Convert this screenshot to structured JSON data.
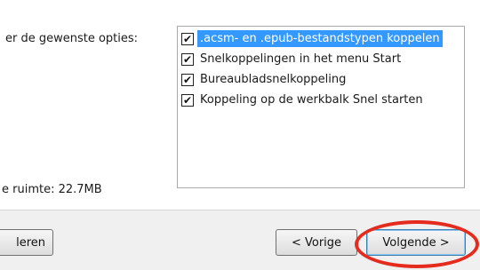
{
  "instruction": "er de gewenste opties:",
  "options": [
    {
      "label": ".acsm- en .epub-bestandstypen koppelen",
      "checked": true,
      "selected": true
    },
    {
      "label": "Snelkoppelingen in het menu Start",
      "checked": true,
      "selected": false
    },
    {
      "label": "Bureaubladsnelkoppeling",
      "checked": true,
      "selected": false
    },
    {
      "label": "Koppeling op de werkbalk Snel starten",
      "checked": true,
      "selected": false
    }
  ],
  "space_required": "e ruimte: 22.7MB",
  "buttons": {
    "cancel": "leren",
    "back": "< Vorige",
    "next": "Volgende >"
  },
  "checkmark": "✔",
  "highlight_color": "#e52b1e",
  "selection_color": "#3399ff"
}
